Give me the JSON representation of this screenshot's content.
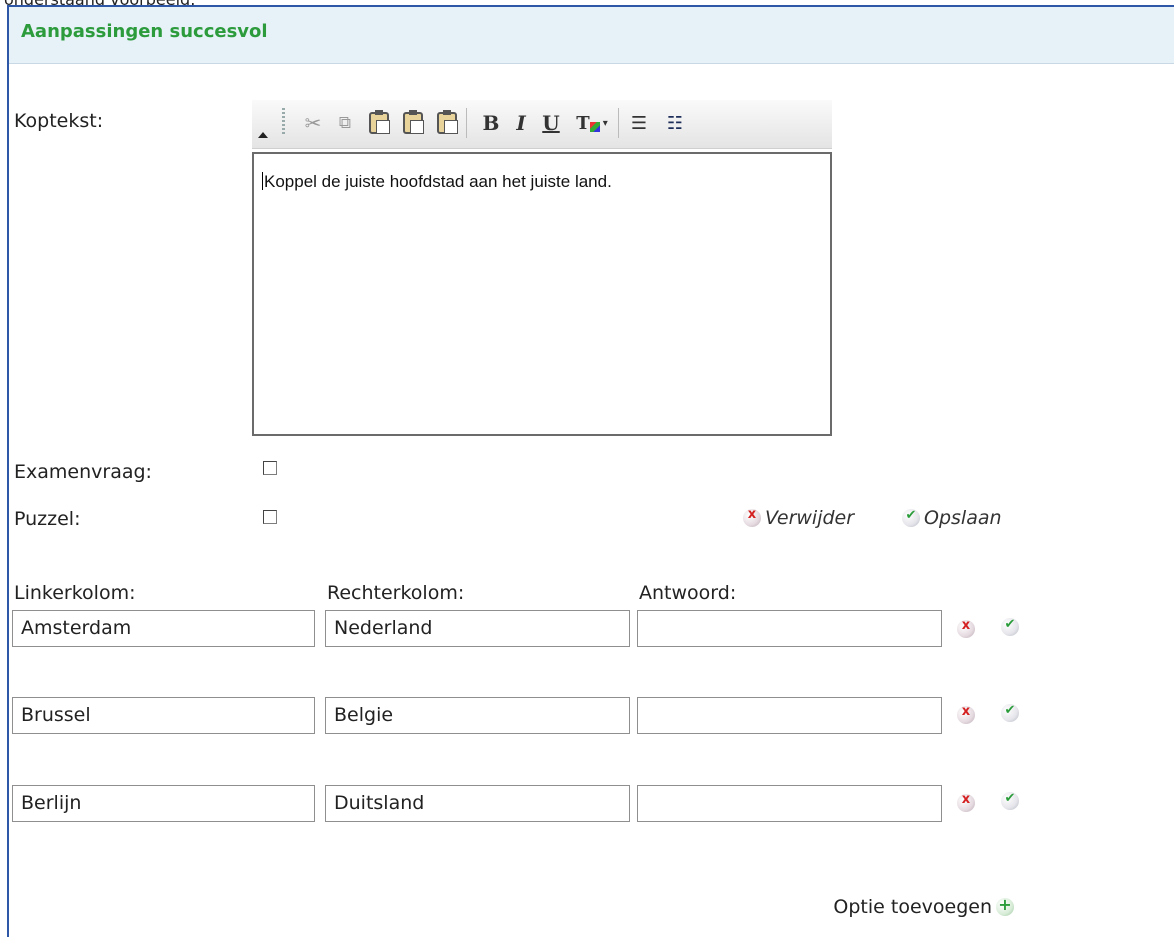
{
  "top_caption": "onderstaand voorbeeld:",
  "panel": {
    "title": "Aanpassingen succesvol"
  },
  "form": {
    "koptekst_label": "Koptekst:",
    "editor": {
      "toolbar": [
        "cut-icon",
        "copy-icon",
        "paste-icon",
        "paste-text-icon",
        "paste-word-icon",
        "bold",
        "italic",
        "underline",
        "text-color-icon",
        "ordered-list-icon",
        "unordered-list-icon"
      ],
      "bold_label": "B",
      "italic_label": "I",
      "underline_label": "U",
      "content": "Koppel de juiste hoofdstad aan het juiste land."
    },
    "examenvraag_label": "Examenvraag:",
    "puzzel_label": "Puzzel:",
    "examenvraag_checked": false,
    "puzzel_checked": false,
    "delete_label": "Verwijder",
    "save_label": "Opslaan"
  },
  "pairs": {
    "headers": {
      "left": "Linkerkolom:",
      "right": "Rechterkolom:",
      "answer": "Antwoord:"
    },
    "rows": [
      {
        "left": "Amsterdam",
        "right": "Nederland",
        "answer": ""
      },
      {
        "left": "Brussel",
        "right": "Belgie",
        "answer": ""
      },
      {
        "left": "Berlijn",
        "right": "Duitsland",
        "answer": ""
      }
    ]
  },
  "add_option_label": "Optie toevoegen",
  "colors": {
    "title_green": "#2c9b3c",
    "panel_border": "#2e57a7",
    "header_bg": "#e6f1f8"
  }
}
